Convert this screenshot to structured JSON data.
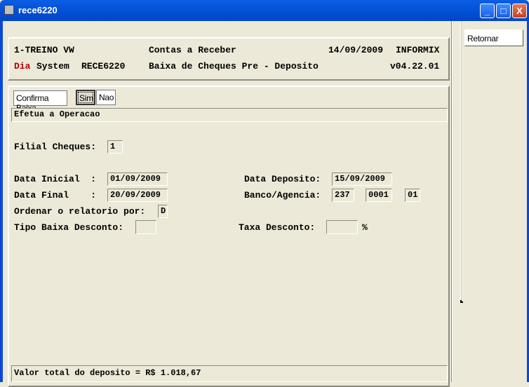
{
  "window": {
    "title": "rece6220",
    "minimize": "_",
    "maximize": "□",
    "close": "X"
  },
  "header": {
    "company": "1-TREINO VW",
    "module": "Contas a Receber",
    "date": "14/09/2009",
    "db": "INFORMIX",
    "brand_red": "Dia",
    "brand_rest": "System",
    "program": "RECE6220",
    "screen_title": "Baixa de Cheques Pre - Deposito",
    "version": "v04.22.01",
    "brand_color": "#B00000"
  },
  "confirm": {
    "label": "Confirma Baixa",
    "yes": "Sim",
    "no": "Nao",
    "message": "Efetua a Operacao"
  },
  "form": {
    "filial_label": "Filial Cheques:",
    "filial_value": "1",
    "data_inicial_label": "Data Inicial  :",
    "data_inicial_value": "01/09/2009",
    "data_final_label": "Data Final    :",
    "data_final_value": "20/09/2009",
    "ordenar_label": "Ordenar o relatorio por:",
    "ordenar_value": "D",
    "tipo_label": "Tipo Baixa Desconto:",
    "tipo_value": "",
    "data_deposito_label": "Data Deposito:",
    "data_deposito_value": "15/09/2009",
    "banco_label": "Banco/Agencia:",
    "banco_value": "237",
    "agencia_value": "0001",
    "digito_value": "01",
    "taxa_label": "Taxa Desconto:",
    "taxa_value": "",
    "percent": "%"
  },
  "status": {
    "total": "Valor total do deposito = R$ 1.018,67"
  },
  "side": {
    "retornar": "Retornar"
  }
}
